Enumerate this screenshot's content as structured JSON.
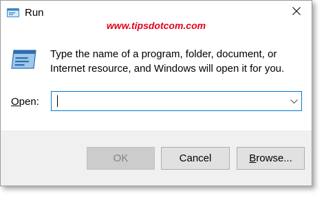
{
  "window": {
    "title": "Run",
    "watermark": "www.tipsdotcom.com"
  },
  "dialog": {
    "description_line1": "Type the name of a program, folder, document, or",
    "description_line2": "Internet resource, and Windows will open it for you.",
    "open_label_mnemonic": "O",
    "open_label_rest": "pen:",
    "open_value": "",
    "open_placeholder": ""
  },
  "buttons": {
    "ok": "OK",
    "cancel": "Cancel",
    "browse_mnemonic": "B",
    "browse_rest": "rowse..."
  },
  "icons": {
    "app": "run-app-icon",
    "close": "close-icon",
    "dropdown": "chevron-down-icon"
  },
  "colors": {
    "watermark": "#e2001a",
    "focus_border": "#0078d7",
    "footer_bg": "#f0f0f0",
    "button_bg": "#e1e1e1",
    "disabled_text": "#838383"
  },
  "state": {
    "ok_enabled": false
  }
}
